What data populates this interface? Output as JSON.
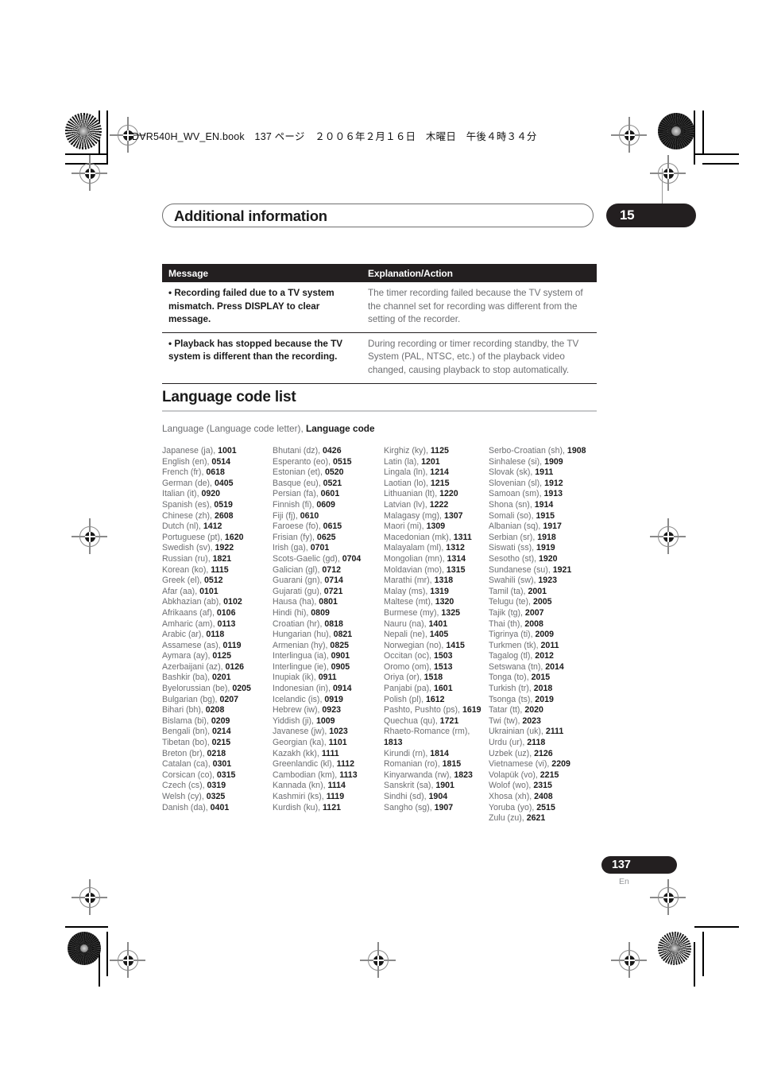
{
  "print_header": {
    "book_line": "DVR540H_WV_EN.book　137 ページ　２００６年２月１６日　木曜日　午後４時３４分"
  },
  "chapter": {
    "title": "Additional information",
    "number": "15"
  },
  "message_table": {
    "headers": [
      "Message",
      "Explanation/Action"
    ],
    "rows": [
      {
        "message": "• Recording failed due to a TV system mismatch. Press DISPLAY to clear message.",
        "explanation": "The timer recording failed because the TV system of the channel set for recording was different from the setting of the recorder."
      },
      {
        "message": "• Playback has stopped because the TV system is different than the recording.",
        "explanation": "During recording or timer recording standby, the TV System (PAL, NTSC, etc.) of the playback video changed, causing playback to stop automatically."
      }
    ]
  },
  "section": {
    "heading": "Language code list",
    "subtitle_plain": "Language (Language code letter), ",
    "subtitle_bold": "Language code"
  },
  "language_columns": [
    [
      {
        "name": "Japanese (ja), ",
        "code": "1001"
      },
      {
        "name": "English (en), ",
        "code": "0514"
      },
      {
        "name": "French (fr), ",
        "code": "0618"
      },
      {
        "name": "German (de), ",
        "code": "0405"
      },
      {
        "name": "Italian (it), ",
        "code": "0920"
      },
      {
        "name": "Spanish (es), ",
        "code": "0519"
      },
      {
        "name": "Chinese (zh), ",
        "code": "2608"
      },
      {
        "name": "Dutch (nl), ",
        "code": "1412"
      },
      {
        "name": "Portuguese (pt), ",
        "code": "1620"
      },
      {
        "name": "Swedish (sv), ",
        "code": "1922"
      },
      {
        "name": "Russian (ru), ",
        "code": "1821"
      },
      {
        "name": "Korean (ko), ",
        "code": "1115"
      },
      {
        "name": "Greek (el), ",
        "code": "0512"
      },
      {
        "name": "Afar (aa), ",
        "code": "0101"
      },
      {
        "name": "Abkhazian (ab), ",
        "code": "0102"
      },
      {
        "name": "Afrikaans (af), ",
        "code": "0106"
      },
      {
        "name": "Amharic (am), ",
        "code": "0113"
      },
      {
        "name": "Arabic (ar), ",
        "code": "0118"
      },
      {
        "name": "Assamese (as), ",
        "code": "0119"
      },
      {
        "name": "Aymara (ay), ",
        "code": "0125"
      },
      {
        "name": "Azerbaijani (az), ",
        "code": "0126"
      },
      {
        "name": "Bashkir (ba), ",
        "code": "0201"
      },
      {
        "name": "Byelorussian (be), ",
        "code": "0205"
      },
      {
        "name": "Bulgarian (bg), ",
        "code": "0207"
      },
      {
        "name": "Bihari (bh), ",
        "code": "0208"
      },
      {
        "name": "Bislama (bi), ",
        "code": "0209"
      },
      {
        "name": "Bengali (bn), ",
        "code": "0214"
      },
      {
        "name": "Tibetan (bo), ",
        "code": "0215"
      },
      {
        "name": "Breton (br), ",
        "code": "0218"
      },
      {
        "name": "Catalan (ca), ",
        "code": "0301"
      },
      {
        "name": "Corsican (co), ",
        "code": "0315"
      },
      {
        "name": "Czech (cs), ",
        "code": "0319"
      },
      {
        "name": "Welsh (cy), ",
        "code": "0325"
      },
      {
        "name": "Danish (da), ",
        "code": "0401"
      }
    ],
    [
      {
        "name": "Bhutani (dz), ",
        "code": "0426"
      },
      {
        "name": "Esperanto (eo), ",
        "code": "0515"
      },
      {
        "name": "Estonian (et), ",
        "code": "0520"
      },
      {
        "name": "Basque (eu), ",
        "code": "0521"
      },
      {
        "name": "Persian (fa), ",
        "code": "0601"
      },
      {
        "name": "Finnish (fi), ",
        "code": "0609"
      },
      {
        "name": "Fiji (fj), ",
        "code": "0610"
      },
      {
        "name": "Faroese (fo), ",
        "code": "0615"
      },
      {
        "name": "Frisian (fy), ",
        "code": "0625"
      },
      {
        "name": "Irish (ga), ",
        "code": "0701"
      },
      {
        "name": "Scots-Gaelic (gd), ",
        "code": "0704"
      },
      {
        "name": "Galician (gl), ",
        "code": "0712"
      },
      {
        "name": "Guarani (gn), ",
        "code": "0714"
      },
      {
        "name": "Gujarati (gu), ",
        "code": "0721"
      },
      {
        "name": "Hausa (ha), ",
        "code": "0801"
      },
      {
        "name": "Hindi (hi), ",
        "code": "0809"
      },
      {
        "name": "Croatian (hr), ",
        "code": "0818"
      },
      {
        "name": "Hungarian (hu), ",
        "code": "0821"
      },
      {
        "name": "Armenian (hy), ",
        "code": "0825"
      },
      {
        "name": "Interlingua (ia), ",
        "code": "0901"
      },
      {
        "name": "Interlingue (ie), ",
        "code": "0905"
      },
      {
        "name": "Inupiak (ik), ",
        "code": "0911"
      },
      {
        "name": "Indonesian (in), ",
        "code": "0914"
      },
      {
        "name": "Icelandic (is), ",
        "code": "0919"
      },
      {
        "name": "Hebrew (iw), ",
        "code": "0923"
      },
      {
        "name": "Yiddish (ji), ",
        "code": "1009"
      },
      {
        "name": "Javanese (jw), ",
        "code": "1023"
      },
      {
        "name": "Georgian (ka), ",
        "code": "1101"
      },
      {
        "name": "Kazakh (kk), ",
        "code": "1111"
      },
      {
        "name": "Greenlandic (kl), ",
        "code": "1112"
      },
      {
        "name": "Cambodian (km), ",
        "code": "1113"
      },
      {
        "name": "Kannada (kn), ",
        "code": "1114"
      },
      {
        "name": "Kashmiri (ks), ",
        "code": "1119"
      },
      {
        "name": "Kurdish (ku), ",
        "code": "1121"
      }
    ],
    [
      {
        "name": "Kirghiz (ky), ",
        "code": "1125"
      },
      {
        "name": "Latin (la), ",
        "code": "1201"
      },
      {
        "name": "Lingala (ln), ",
        "code": "1214"
      },
      {
        "name": "Laotian (lo), ",
        "code": "1215"
      },
      {
        "name": "Lithuanian (lt), ",
        "code": "1220"
      },
      {
        "name": "Latvian (lv), ",
        "code": "1222"
      },
      {
        "name": "Malagasy (mg), ",
        "code": "1307"
      },
      {
        "name": "Maori (mi), ",
        "code": "1309"
      },
      {
        "name": "Macedonian (mk), ",
        "code": "1311"
      },
      {
        "name": "Malayalam (ml), ",
        "code": "1312"
      },
      {
        "name": "Mongolian (mn), ",
        "code": "1314"
      },
      {
        "name": "Moldavian (mo), ",
        "code": "1315"
      },
      {
        "name": "Marathi (mr), ",
        "code": "1318"
      },
      {
        "name": "Malay (ms), ",
        "code": "1319"
      },
      {
        "name": "Maltese (mt), ",
        "code": "1320"
      },
      {
        "name": "Burmese (my), ",
        "code": "1325"
      },
      {
        "name": "Nauru (na), ",
        "code": "1401"
      },
      {
        "name": "Nepali (ne), ",
        "code": "1405"
      },
      {
        "name": "Norwegian (no), ",
        "code": "1415"
      },
      {
        "name": "Occitan (oc), ",
        "code": "1503"
      },
      {
        "name": "Oromo (om), ",
        "code": "1513"
      },
      {
        "name": "Oriya (or), ",
        "code": "1518"
      },
      {
        "name": "Panjabi (pa), ",
        "code": "1601"
      },
      {
        "name": "Polish (pl), ",
        "code": "1612"
      },
      {
        "name": "Pashto, Pushto (ps), ",
        "code": "1619"
      },
      {
        "name": "Quechua (qu), ",
        "code": "1721"
      },
      {
        "name": "Rhaeto-Romance (rm), ",
        "code": "1813"
      },
      {
        "name": "Kirundi (rn), ",
        "code": "1814"
      },
      {
        "name": "Romanian (ro), ",
        "code": "1815"
      },
      {
        "name": "Kinyarwanda (rw), ",
        "code": "1823"
      },
      {
        "name": "Sanskrit (sa), ",
        "code": "1901"
      },
      {
        "name": "Sindhi (sd), ",
        "code": "1904"
      },
      {
        "name": "Sangho (sg), ",
        "code": "1907"
      }
    ],
    [
      {
        "name": "Serbo-Croatian (sh), ",
        "code": "1908"
      },
      {
        "name": "Sinhalese (si), ",
        "code": "1909"
      },
      {
        "name": "Slovak (sk), ",
        "code": "1911"
      },
      {
        "name": "Slovenian (sl), ",
        "code": "1912"
      },
      {
        "name": "Samoan (sm), ",
        "code": "1913"
      },
      {
        "name": "Shona (sn), ",
        "code": "1914"
      },
      {
        "name": "Somali (so), ",
        "code": "1915"
      },
      {
        "name": "Albanian (sq), ",
        "code": "1917"
      },
      {
        "name": "Serbian (sr), ",
        "code": "1918"
      },
      {
        "name": "Siswati (ss), ",
        "code": "1919"
      },
      {
        "name": "Sesotho (st), ",
        "code": "1920"
      },
      {
        "name": "Sundanese (su), ",
        "code": "1921"
      },
      {
        "name": "Swahili (sw), ",
        "code": "1923"
      },
      {
        "name": "Tamil (ta), ",
        "code": "2001"
      },
      {
        "name": "Telugu (te), ",
        "code": "2005"
      },
      {
        "name": "Tajik (tg), ",
        "code": "2007"
      },
      {
        "name": "Thai (th), ",
        "code": "2008"
      },
      {
        "name": "Tigrinya (ti), ",
        "code": "2009"
      },
      {
        "name": "Turkmen (tk), ",
        "code": "2011"
      },
      {
        "name": "Tagalog (tl), ",
        "code": "2012"
      },
      {
        "name": "Setswana (tn), ",
        "code": "2014"
      },
      {
        "name": "Tonga (to), ",
        "code": "2015"
      },
      {
        "name": "Turkish (tr), ",
        "code": "2018"
      },
      {
        "name": "Tsonga (ts), ",
        "code": "2019"
      },
      {
        "name": "Tatar (tt), ",
        "code": "2020"
      },
      {
        "name": "Twi (tw), ",
        "code": "2023"
      },
      {
        "name": "Ukrainian (uk), ",
        "code": "2111"
      },
      {
        "name": "Urdu (ur), ",
        "code": "2118"
      },
      {
        "name": "Uzbek (uz), ",
        "code": "2126"
      },
      {
        "name": "Vietnamese (vi), ",
        "code": "2209"
      },
      {
        "name": "Volapük (vo), ",
        "code": "2215"
      },
      {
        "name": "Wolof (wo), ",
        "code": "2315"
      },
      {
        "name": "Xhosa (xh), ",
        "code": "2408"
      },
      {
        "name": "Yoruba (yo), ",
        "code": "2515"
      },
      {
        "name": "Zulu (zu), ",
        "code": "2621"
      }
    ]
  ],
  "footer": {
    "page_number": "137",
    "language_code": "En"
  },
  "colors": {
    "ink_black": "#231f20",
    "body_gray": "#6d6e71",
    "rule_gray": "#c7c8ca"
  }
}
